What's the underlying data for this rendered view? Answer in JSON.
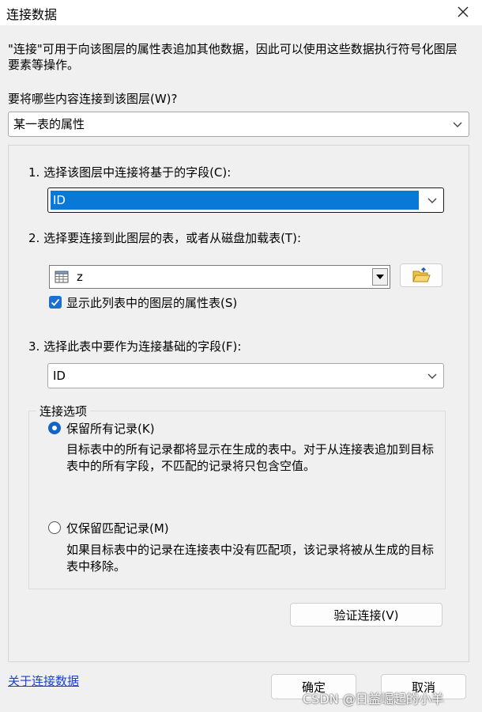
{
  "window": {
    "title": "连接数据"
  },
  "description": "\"连接\"可用于向该图层的属性表追加其他数据，因此可以使用这些数据执行符号化图层要素等操作。",
  "join_what": {
    "label": "要将哪些内容连接到该图层(W)?",
    "selected": "某一表的属性"
  },
  "step1": {
    "label": "1. 选择该图层中连接将基于的字段(C):",
    "selected": "ID"
  },
  "step2": {
    "label": "2. 选择要连接到此图层的表，或者从磁盘加载表(T):",
    "selected": "z",
    "checkbox_label": "显示此列表中的图层的属性表(S)",
    "checked": true
  },
  "step3": {
    "label": "3. 选择此表中要作为连接基础的字段(F):",
    "selected": "ID"
  },
  "join_options": {
    "title": "连接选项",
    "keep_all": {
      "label": "保留所有记录(K)",
      "desc": "目标表中的所有记录都将显示在生成的表中。对于从连接表追加到目标表中的所有字段，不匹配的记录将只包含空值。"
    },
    "keep_matching": {
      "label": "仅保留匹配记录(M)",
      "desc": "如果目标表中的记录在连接表中没有匹配项，该记录将被从生成的目标表中移除。"
    }
  },
  "validate_button": "验证连接(V)",
  "about_link": "关于连接数据",
  "ok_button": "确定",
  "cancel_button": "取消",
  "watermark": "CSDN @日益崛起的小羊"
}
